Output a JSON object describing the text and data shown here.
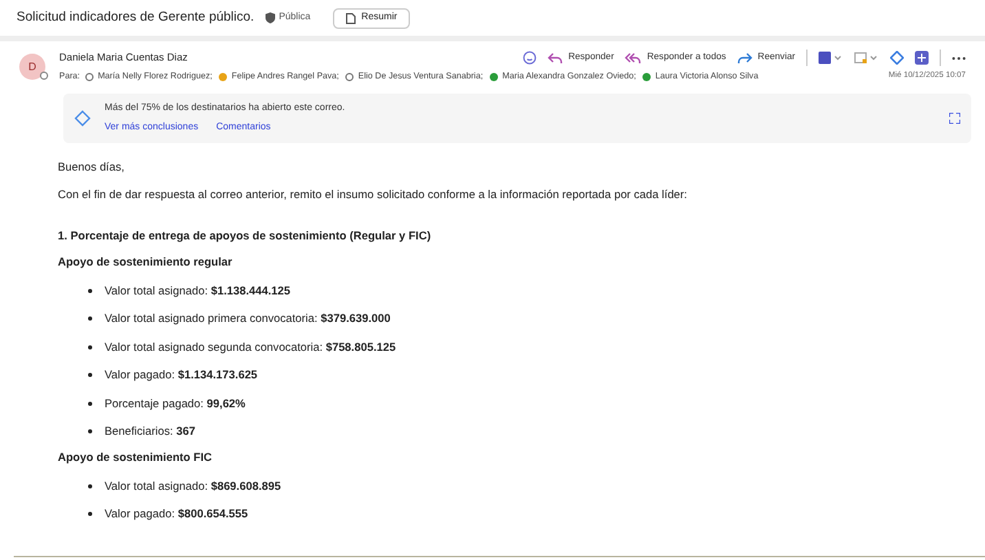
{
  "subject": {
    "title": "Solicitud indicadores de Gerente público.",
    "sensitivity": "Pública",
    "summarize_button": "Resumir"
  },
  "message": {
    "avatar_initial": "D",
    "sender": "Daniela Maria Cuentas Diaz",
    "to_label": "Para:",
    "recipients": [
      {
        "name": "María Nelly Florez Rodriguez;",
        "kind": "ring"
      },
      {
        "name": "Felipe Andres Rangel Pava;",
        "kind": "dot",
        "color": "#e8a317"
      },
      {
        "name": "Elio De Jesus Ventura Sanabria;",
        "kind": "ring"
      },
      {
        "name": "Maria Alexandra Gonzalez Oviedo;",
        "kind": "dot",
        "color": "#2a9d3a"
      },
      {
        "name": "Laura Victoria Alonso Silva",
        "kind": "dot",
        "color": "#2a9d3a"
      }
    ],
    "date": "Mié 10/12/2025 10:07",
    "actions": [
      {
        "label": "Responder",
        "kind": "reply"
      },
      {
        "label": "Responder a todos",
        "kind": "reply-all"
      },
      {
        "label": "Reenviar",
        "kind": "forward"
      }
    ]
  },
  "insights": {
    "text": "Más del 75% de los destinatarios ha abierto este correo.",
    "links": [
      "Ver más conclusiones",
      "Comentarios"
    ]
  },
  "body": {
    "greeting": "Buenos días,",
    "intro": "Con el fin de dar respuesta al correo anterior, remito el insumo solicitado conforme a la información reportada por cada líder:",
    "heading": "1. Porcentaje de entrega de apoyos de sostenimiento (Regular y FIC)",
    "sections": [
      {
        "title": "Apoyo de sostenimiento regular",
        "items": [
          {
            "label": "Valor total asignado:",
            "value": "$1.138.444.125"
          },
          {
            "label": "Valor total asignado primera convocatoria:",
            "value": "$379.639.000"
          },
          {
            "label": "Valor total asignado segunda convocatoria:",
            "value": "$758.805.125"
          },
          {
            "label": "Valor pagado:",
            "value": "$1.134.173.625"
          },
          {
            "label": "Porcentaje pagado:",
            "value": "99,62%"
          },
          {
            "label": "Beneficiarios:",
            "value": "367"
          }
        ]
      },
      {
        "title": "Apoyo de sostenimiento FIC",
        "items": [
          {
            "label": "Valor total asignado:",
            "value": "$869.608.895"
          },
          {
            "label": "Valor pagado:",
            "value": "$800.654.555"
          }
        ]
      }
    ]
  }
}
